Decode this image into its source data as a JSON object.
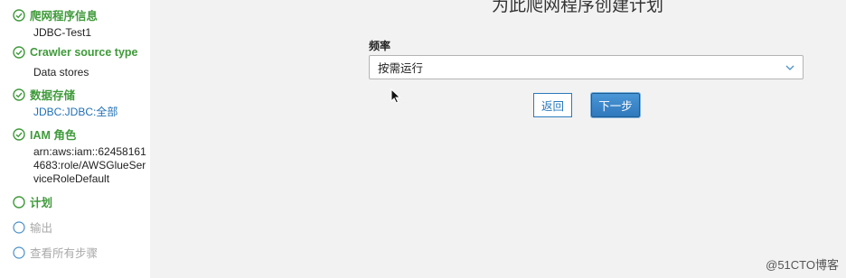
{
  "steps": [
    {
      "label": "爬网程序信息",
      "state": "done"
    },
    {
      "label": "Crawler source type",
      "state": "done"
    },
    {
      "label": "数据存储",
      "state": "done"
    },
    {
      "label": "IAM 角色",
      "state": "done"
    },
    {
      "label": "计划",
      "state": "current"
    },
    {
      "label": "输出",
      "state": "future"
    },
    {
      "label": "查看所有步骤",
      "state": "future"
    }
  ],
  "details": {
    "crawler_info": "JDBC-Test1",
    "source_type": "Data stores",
    "data_store": "JDBC:JDBC:全部",
    "iam_role": "arn:aws:iam::624581614683:role/AWSGlueServiceRoleDefault"
  },
  "main": {
    "title": "为此爬网程序创建计划",
    "frequency_label": "频率",
    "frequency_value": "按需运行",
    "back_label": "返回",
    "next_label": "下一步"
  },
  "watermark": "@51CTO博客",
  "colors": {
    "done": "#3f9a3a",
    "future": "#a8a8a8",
    "link": "#1f6fb5",
    "primary": "#2f78bc"
  }
}
